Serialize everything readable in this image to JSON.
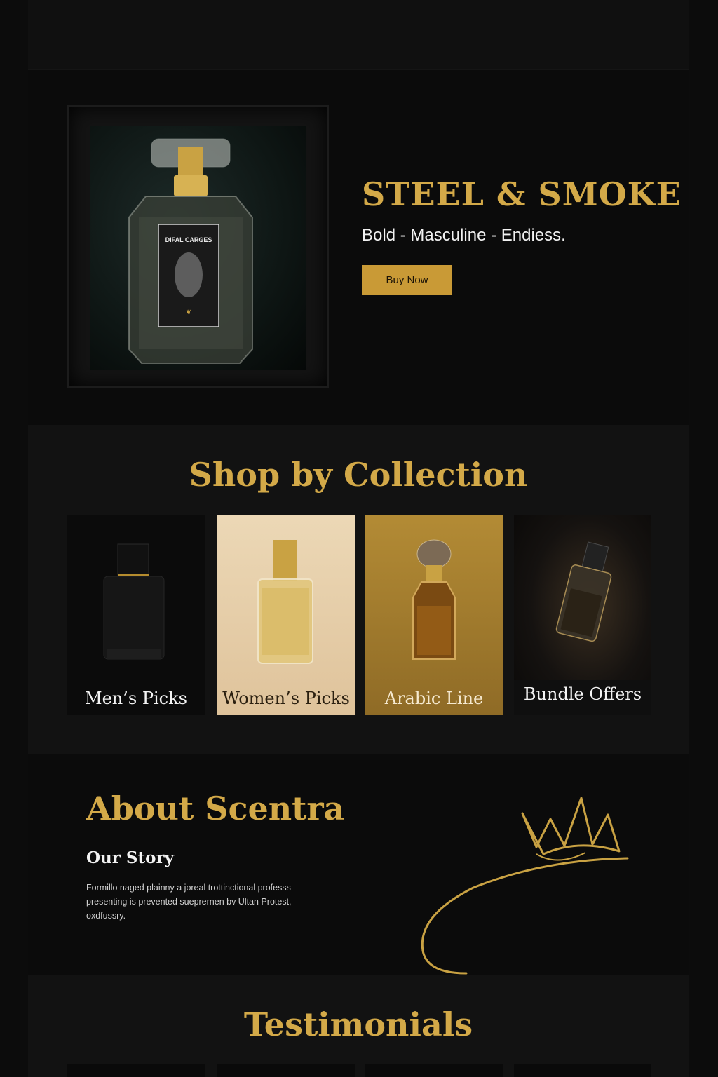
{
  "hero": {
    "title": "STEEL & SMOKE",
    "subtitle": "Bold - Masculine - Endiess.",
    "buy_label": "Buy Now",
    "bottle_label": "DIFAL CARGES"
  },
  "collection": {
    "title": "Shop by Collection",
    "cards": [
      {
        "label": "Men’s Picks"
      },
      {
        "label": "Women’s Picks"
      },
      {
        "label": "Arabic Line"
      },
      {
        "label": "Bundle Offers"
      }
    ]
  },
  "about": {
    "title": "About Scentra",
    "story_title": "Our Story",
    "story_text": "Formillo naged plainny a joreal trottinctional professs— presenting is prevented sueprernen bv Ultan Protest, oxdfussry."
  },
  "testimonials": {
    "title": "Testimonials"
  },
  "colors": {
    "gold": "#d3a948",
    "button": "#c99a36",
    "background": "#0c0c0c"
  }
}
